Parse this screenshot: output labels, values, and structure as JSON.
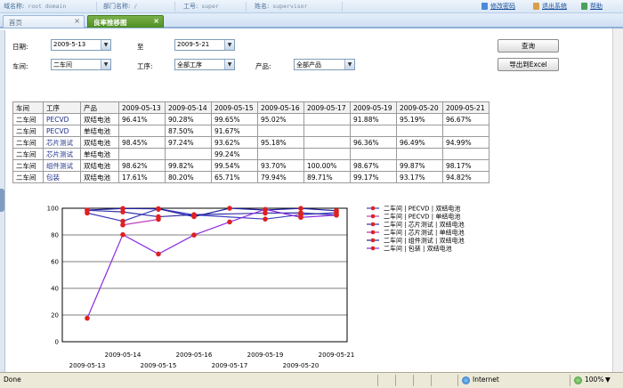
{
  "userbar": {
    "domain_label": "域名称:",
    "domain_value": "root domain",
    "dept_label": "部门名称:",
    "dept_value": "/",
    "empno_label": "工号:",
    "empno_value": "super",
    "name_label": "姓名:",
    "name_value": "supervisor",
    "change_pwd": "修改密码",
    "logout": "退出系统",
    "help": "帮助"
  },
  "tabs": [
    {
      "label": "首页",
      "close": "×"
    },
    {
      "label": "良率推移图",
      "close": "×"
    }
  ],
  "filters": {
    "date_label": "日期:",
    "date_from": "2009-5-13",
    "to_label": "至",
    "date_to": "2009-5-21",
    "workshop_label": "车间:",
    "workshop_value": "二车间",
    "process_label": "工序:",
    "process_value": "全部工序",
    "product_label": "产品:",
    "product_value": "全部产品",
    "query_button": "查询",
    "export_button": "导出到Excel"
  },
  "table": {
    "headers": [
      "车间",
      "工序",
      "产品",
      "2009-05-13",
      "2009-05-14",
      "2009-05-15",
      "2009-05-16",
      "2009-05-17",
      "2009-05-19",
      "2009-05-20",
      "2009-05-21"
    ],
    "rows": [
      [
        "二车间",
        "PECVD",
        "双结电池",
        "96.41%",
        "90.28%",
        "99.65%",
        "95.02%",
        "",
        "91.88%",
        "95.19%",
        "96.67%"
      ],
      [
        "二车间",
        "PECVD",
        "单结电池",
        "",
        "87.50%",
        "91.67%",
        "",
        "",
        "",
        "",
        ""
      ],
      [
        "二车间",
        "芯片测试",
        "双结电池",
        "98.45%",
        "97.24%",
        "93.62%",
        "95.18%",
        "",
        "96.36%",
        "96.49%",
        "94.99%"
      ],
      [
        "二车间",
        "芯片测试",
        "单结电池",
        "",
        "",
        "99.24%",
        "",
        "",
        "",
        "",
        ""
      ],
      [
        "二车间",
        "组件测试",
        "双结电池",
        "98.62%",
        "99.82%",
        "99.54%",
        "93.70%",
        "100.00%",
        "98.67%",
        "99.87%",
        "98.17%"
      ],
      [
        "二车间",
        "包装",
        "双结电池",
        "17.61%",
        "80.20%",
        "65.71%",
        "79.94%",
        "89.71%",
        "99.17%",
        "93.17%",
        "94.82%"
      ]
    ]
  },
  "chart_data": {
    "type": "line",
    "x_upper": [
      "2009-05-14",
      "2009-05-16",
      "2009-05-19",
      "2009-05-21"
    ],
    "x_lower": [
      "2009-05-13",
      "2009-05-15",
      "2009-05-17",
      "2009-05-20"
    ],
    "categories": [
      "2009-05-13",
      "2009-05-14",
      "2009-05-15",
      "2009-05-16",
      "2009-05-17",
      "2009-05-19",
      "2009-05-20",
      "2009-05-21"
    ],
    "ylim": [
      0,
      100
    ],
    "yticks": [
      0,
      20,
      40,
      60,
      80,
      100
    ],
    "grid": true,
    "legend_position": "right",
    "series": [
      {
        "name": "二车间 | PECVD | 双结电池",
        "color": "#4040c0",
        "values": [
          96.41,
          90.28,
          99.65,
          95.02,
          null,
          91.88,
          95.19,
          96.67
        ]
      },
      {
        "name": "二车间 | PECVD | 单结电池",
        "color": "#c040c0",
        "values": [
          null,
          87.5,
          91.67,
          null,
          null,
          null,
          null,
          null
        ]
      },
      {
        "name": "二车间 | 芯片测试 | 双结电池",
        "color": "#3030a8",
        "values": [
          98.45,
          97.24,
          93.62,
          95.18,
          null,
          96.36,
          96.49,
          94.99
        ]
      },
      {
        "name": "二车间 | 芯片测试 | 单结电池",
        "color": "#b030b0",
        "values": [
          null,
          null,
          99.24,
          null,
          null,
          null,
          null,
          null
        ]
      },
      {
        "name": "二车间 | 组件测试 | 双结电池",
        "color": "#2020a0",
        "values": [
          98.62,
          99.82,
          99.54,
          93.7,
          100.0,
          98.67,
          99.87,
          98.17
        ]
      },
      {
        "name": "二车间 | 包装 | 双结电池",
        "color": "#8a2be2",
        "values": [
          17.61,
          80.2,
          65.71,
          79.94,
          89.71,
          99.17,
          93.17,
          94.82
        ]
      }
    ],
    "marker_color": "#e02020"
  },
  "statusbar": {
    "done": "Done",
    "zone": "Internet",
    "zoom": "100%"
  }
}
